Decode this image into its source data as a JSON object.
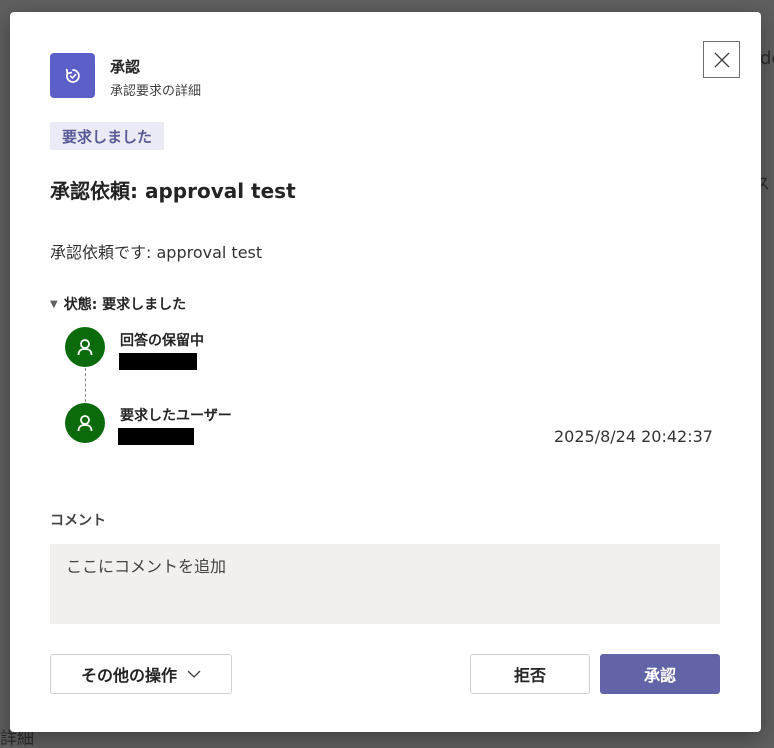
{
  "background": {
    "right_fragment": "de",
    "right_fragment2": "ス",
    "bottom_fragment": "詳細"
  },
  "header": {
    "app_icon": "approval-refresh-icon",
    "title": "承認",
    "subtitle": "承認要求の詳細",
    "close_icon": "close-icon"
  },
  "status_chip": "要求しました",
  "request": {
    "title": "承認依頼: approval test",
    "description": "承認依頼です: approval test"
  },
  "status_section": {
    "toggle_label": "状態: 要求しました",
    "entries": [
      {
        "status": "回答の保留中",
        "avatar_icon": "person-icon"
      },
      {
        "status": "要求したユーザー",
        "avatar_icon": "person-icon",
        "timestamp": "2025/8/24 20:42:37"
      }
    ]
  },
  "comment": {
    "label": "コメント",
    "placeholder": "ここにコメントを追加",
    "value": ""
  },
  "actions": {
    "more_label": "その他の操作",
    "reject_label": "拒否",
    "approve_label": "承認"
  },
  "colors": {
    "accent": "#6264a7",
    "app_icon_bg": "#5b5fc7",
    "chip_bg": "#ebebf5",
    "chip_text": "#585a96",
    "avatar_bg": "#0b6a0b",
    "comment_bg": "#f1f0ee"
  }
}
